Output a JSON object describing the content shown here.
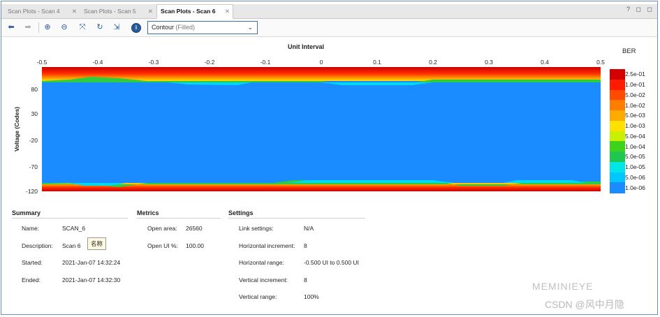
{
  "tabs": [
    {
      "label": "Scan Plots - Scan 4",
      "active": false
    },
    {
      "label": "Scan Plots - Scan 5",
      "active": false
    },
    {
      "label": "Scan Plots - Scan 6",
      "active": true
    }
  ],
  "window_buttons": "? ◻ ◻",
  "toolbar": {
    "icons": [
      "back-arrow-icon",
      "forward-arrow-icon",
      "zoom-in-icon",
      "zoom-out-icon",
      "fit-icon",
      "refresh-icon",
      "export-icon",
      "info-icon"
    ],
    "select_value": "Contour",
    "select_suffix": "(Filled)"
  },
  "chart_data": {
    "type": "heatmap",
    "title": "Unit Interval",
    "ylabel": "Voltage (Codes)",
    "x_ticks": [
      "-0.5",
      "-0.4",
      "-0.3",
      "-0.2",
      "-0.1",
      "0",
      "0.1",
      "0.2",
      "0.3",
      "0.4",
      "0.5"
    ],
    "y_ticks": [
      "80",
      "30",
      "-20",
      "-70",
      "-120"
    ],
    "xlim": [
      -0.5,
      0.5
    ],
    "colorbar_title": "BER",
    "colorbar": [
      {
        "label": "2.5e-01",
        "color": "#d40000"
      },
      {
        "label": "1.0e-01",
        "color": "#ff1a00"
      },
      {
        "label": "5.0e-02",
        "color": "#ff4b00"
      },
      {
        "label": "1.0e-02",
        "color": "#ff7d00"
      },
      {
        "label": "5.0e-03",
        "color": "#ffaa00"
      },
      {
        "label": "1.0e-03",
        "color": "#ffe100"
      },
      {
        "label": "5.0e-04",
        "color": "#c8f000"
      },
      {
        "label": "1.0e-04",
        "color": "#3ed21a"
      },
      {
        "label": "5.0e-05",
        "color": "#1ec850"
      },
      {
        "label": "1.0e-05",
        "color": "#00e6e6"
      },
      {
        "label": "5.0e-06",
        "color": "#00c8ff"
      },
      {
        "label": "1.0e-06",
        "color": "#1a8cff"
      }
    ]
  },
  "summary": {
    "title": "Summary",
    "rows": [
      {
        "k": "Name:",
        "v": "SCAN_6"
      },
      {
        "k": "Description:",
        "v": "Scan 6"
      },
      {
        "k": "Started:",
        "v": "2021-Jan-07 14:32:24"
      },
      {
        "k": "Ended:",
        "v": "2021-Jan-07 14:32:30"
      }
    ],
    "tooltip": "名称"
  },
  "metrics": {
    "title": "Metrics",
    "rows": [
      {
        "k": "Open area:",
        "v": "26560"
      },
      {
        "k": "Open UI %:",
        "v": "100.00"
      }
    ]
  },
  "settings": {
    "title": "Settings",
    "rows": [
      {
        "k": "Link settings:",
        "v": "N/A"
      },
      {
        "k": "Horizontal increment:",
        "v": "8"
      },
      {
        "k": "Horizontal range:",
        "v": "-0.500 UI to 0.500 UI"
      },
      {
        "k": "Vertical increment:",
        "v": "8"
      },
      {
        "k": "Vertical range:",
        "v": "100%"
      }
    ]
  },
  "watermark": {
    "line1": "MEMINIEYE",
    "line2": "CSDN @风中月隐"
  }
}
